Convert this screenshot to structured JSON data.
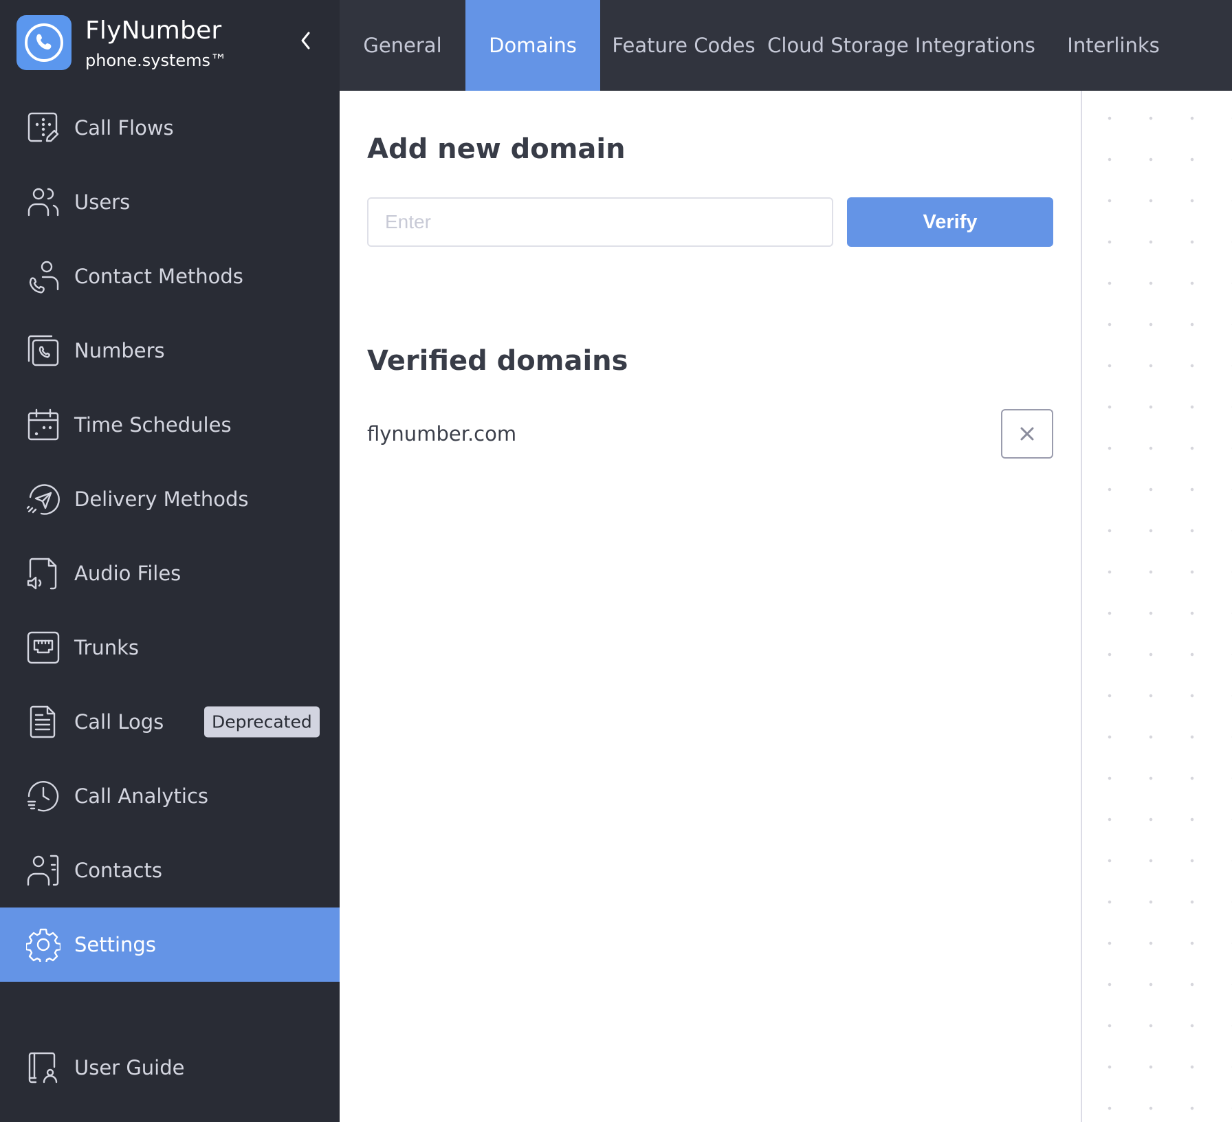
{
  "brand": {
    "name": "FlyNumber",
    "subtitle": "phone.systems™",
    "logo_icon": "phone-circle-icon",
    "collapse_icon": "chevron-left-icon"
  },
  "sidebar": {
    "items": [
      {
        "label": "Call Flows",
        "icon": "call-flows-icon",
        "active": false
      },
      {
        "label": "Users",
        "icon": "users-icon",
        "active": false
      },
      {
        "label": "Contact Methods",
        "icon": "contact-methods-icon",
        "active": false
      },
      {
        "label": "Numbers",
        "icon": "numbers-icon",
        "active": false
      },
      {
        "label": "Time Schedules",
        "icon": "calendar-icon",
        "active": false
      },
      {
        "label": "Delivery Methods",
        "icon": "send-icon",
        "active": false
      },
      {
        "label": "Audio Files",
        "icon": "audio-file-icon",
        "active": false
      },
      {
        "label": "Trunks",
        "icon": "ethernet-port-icon",
        "active": false
      },
      {
        "label": "Call Logs",
        "icon": "document-icon",
        "active": false,
        "badge": "Deprecated"
      },
      {
        "label": "Call Analytics",
        "icon": "history-clock-icon",
        "active": false
      },
      {
        "label": "Contacts",
        "icon": "contacts-icon",
        "active": false
      },
      {
        "label": "Settings",
        "icon": "gear-icon",
        "active": true
      }
    ],
    "bottom": {
      "label": "User Guide",
      "icon": "user-guide-icon"
    }
  },
  "tabs": [
    {
      "label": "General",
      "active": false
    },
    {
      "label": "Domains",
      "active": true
    },
    {
      "label": "Feature Codes",
      "active": false
    },
    {
      "label": "Cloud Storage Integrations",
      "active": false
    },
    {
      "label": "Interlinks",
      "active": false
    }
  ],
  "add_domain": {
    "title": "Add new domain",
    "input_value": "",
    "input_placeholder": "Enter",
    "verify_label": "Verify"
  },
  "verified": {
    "title": "Verified domains",
    "domains": [
      "flynumber.com"
    ],
    "remove_icon": "close-icon"
  },
  "colors": {
    "accent": "#6494e6",
    "sidebar_bg": "#292c35",
    "header_bg": "#31343e",
    "logo_bg": "#5b97ee",
    "badge_bg": "#d2d4e0"
  }
}
